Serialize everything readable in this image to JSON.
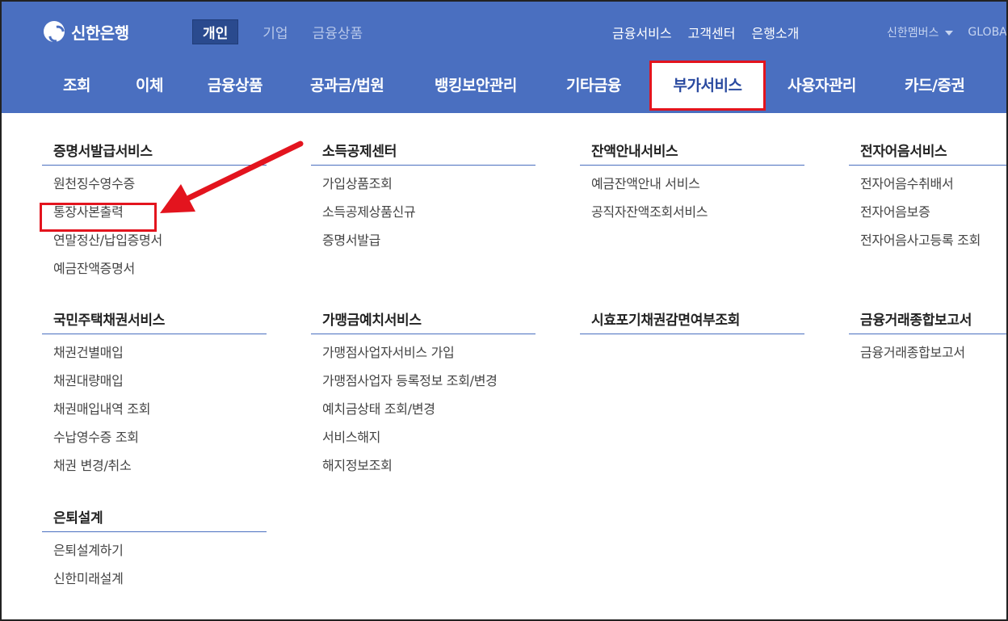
{
  "brand": {
    "name": "신한은행"
  },
  "segments": [
    {
      "label": "개인",
      "active": true
    },
    {
      "label": "기업",
      "active": false
    },
    {
      "label": "금융상품",
      "active": false
    }
  ],
  "utility": {
    "items": [
      "금융서비스",
      "고객센터",
      "은행소개"
    ],
    "membership": "신한멤버스",
    "global": "GLOBAL"
  },
  "gnb": [
    "조회",
    "이체",
    "금융상품",
    "공과금/법원",
    "뱅킹보안관리",
    "기타금융",
    "부가서비스",
    "사용자관리",
    "카드/증권"
  ],
  "columns": [
    {
      "sections": [
        {
          "title": "증명서발급서비스",
          "items": [
            "원천징수영수증",
            "통장사본출력",
            "연말정산/납입증명서",
            "예금잔액증명서"
          ]
        },
        {
          "title": "국민주택채권서비스",
          "items": [
            "채권건별매입",
            "채권대량매입",
            "채권매입내역 조회",
            "수납영수증 조회",
            "채권 변경/취소"
          ]
        },
        {
          "title": "은퇴설계",
          "items": [
            "은퇴설계하기",
            "신한미래설계"
          ]
        }
      ]
    },
    {
      "sections": [
        {
          "title": "소득공제센터",
          "items": [
            "가입상품조회",
            "소득공제상품신규",
            "증명서발급"
          ]
        },
        {
          "title": "가맹금예치서비스",
          "items": [
            "가맹점사업자서비스 가입",
            "가맹점사업자 등록정보 조회/변경",
            "예치금상태 조회/변경",
            "서비스해지",
            "해지정보조회"
          ]
        }
      ]
    },
    {
      "sections": [
        {
          "title": "잔액안내서비스",
          "items": [
            "예금잔액안내 서비스",
            "공직자잔액조회서비스"
          ]
        },
        {
          "title": "시효포기채권감면여부조회",
          "items": []
        }
      ]
    },
    {
      "sections": [
        {
          "title": "전자어음서비스",
          "items": [
            "전자어음수취배서",
            "전자어음보증",
            "전자어음사고등록 조회"
          ]
        },
        {
          "title": "금융거래종합보고서",
          "items": [
            "금융거래종합보고서"
          ]
        }
      ]
    }
  ],
  "colors": {
    "header": "#4a6fc0",
    "annotation": "#e3141e",
    "active_segment": "#2a4a8e"
  }
}
